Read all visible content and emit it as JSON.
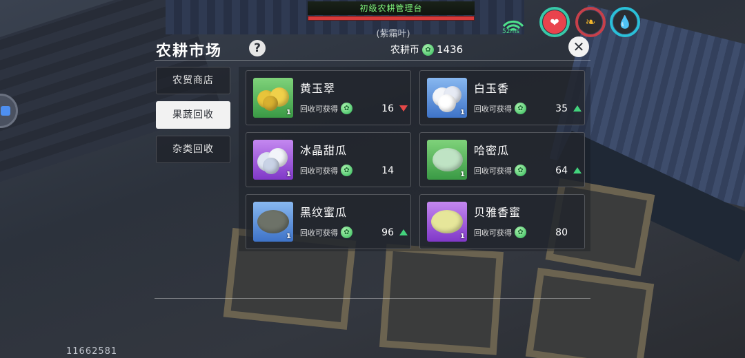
{
  "hud": {
    "station_title": "初级农耕管理台",
    "station_subtitle": "(紫霜叶)",
    "station_health_fraction": 1.0,
    "ping": "52ms",
    "uid": "11662581",
    "colors": {
      "health_bar": "#d83a3a",
      "ping": "#4ee08b"
    }
  },
  "market": {
    "title": "农耕市场",
    "help_icon": "?",
    "coin_label": "农耕币",
    "coin_value": "1436",
    "close_icon": "✕"
  },
  "tabs": [
    {
      "label": "农贸商店",
      "active": false
    },
    {
      "label": "果蔬回收",
      "active": true
    },
    {
      "label": "杂类回收",
      "active": false
    }
  ],
  "items": [
    {
      "name": "黄玉翠",
      "reward_label": "回收可获得",
      "value": "16",
      "trend": "down",
      "qty": "1",
      "bg": "green"
    },
    {
      "name": "白玉香",
      "reward_label": "回收可获得",
      "value": "35",
      "trend": "up",
      "qty": "1",
      "bg": "blue"
    },
    {
      "name": "冰晶甜瓜",
      "reward_label": "回收可获得",
      "value": "14",
      "trend": "none",
      "qty": "1",
      "bg": "purple"
    },
    {
      "name": "哈密瓜",
      "reward_label": "回收可获得",
      "value": "64",
      "trend": "up",
      "qty": "1",
      "bg": "green"
    },
    {
      "name": "黑纹蜜瓜",
      "reward_label": "回收可获得",
      "value": "96",
      "trend": "up",
      "qty": "1",
      "bg": "blue"
    },
    {
      "name": "贝雅香蜜",
      "reward_label": "回收可获得",
      "value": "80",
      "trend": "none",
      "qty": "1",
      "bg": "purple"
    }
  ]
}
